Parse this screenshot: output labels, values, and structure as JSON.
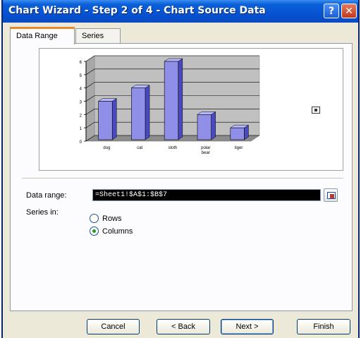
{
  "window": {
    "title": "Chart Wizard - Step 2 of 4 - Chart Source Data",
    "help_label": "?",
    "close_label": "✕"
  },
  "tabs": [
    {
      "label": "Data Range",
      "active": true
    },
    {
      "label": "Series",
      "active": false
    }
  ],
  "chart_data": {
    "type": "bar",
    "categories": [
      "dog",
      "cat",
      "sloth",
      "polar bear",
      "tiger"
    ],
    "values": [
      3,
      4,
      6,
      2,
      1
    ],
    "ylim": [
      0,
      6
    ],
    "yticks": [
      "0",
      "1",
      "2",
      "3",
      "4",
      "5",
      "6"
    ],
    "bar_color": "#8f8fe8",
    "grid": true
  },
  "form": {
    "data_range_label": "Data range:",
    "data_range_value": "=Sheet1!$A$1:$B$7",
    "series_in_label": "Series in:",
    "rows_label": "Rows",
    "columns_label": "Columns",
    "selected": "columns"
  },
  "buttons": {
    "cancel": "Cancel",
    "back": "< Back",
    "next": "Next >",
    "finish": "Finish"
  }
}
